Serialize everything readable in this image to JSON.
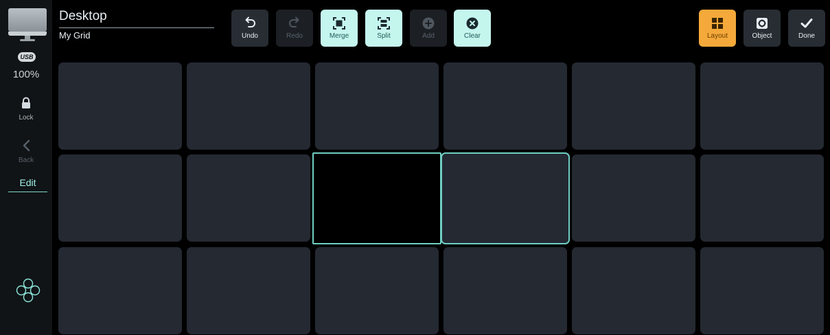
{
  "header": {
    "title": "Desktop",
    "subtitle": "My Grid"
  },
  "sidebar": {
    "device_icon": "monitor-icon",
    "usb_badge": "USB",
    "zoom": "100%",
    "lock_label": "Lock",
    "back_label": "Back",
    "edit_label": "Edit",
    "cluster_icon": "four-circles-icon"
  },
  "toolbar": {
    "undo_label": "Undo",
    "redo_label": "Redo",
    "merge_label": "Merge",
    "split_label": "Split",
    "add_label": "Add",
    "clear_label": "Clear",
    "layout_label": "Layout",
    "object_label": "Object",
    "done_label": "Done"
  },
  "grid": {
    "rows": 3,
    "columns": 6,
    "selected_cells": [
      "row2-col3",
      "row2-col4"
    ]
  },
  "colors": {
    "accent": "#6fcfc2",
    "active_button": "#c5f6ee",
    "layout_button": "#f4a93a",
    "cell": "#242932",
    "background": "#000000"
  }
}
